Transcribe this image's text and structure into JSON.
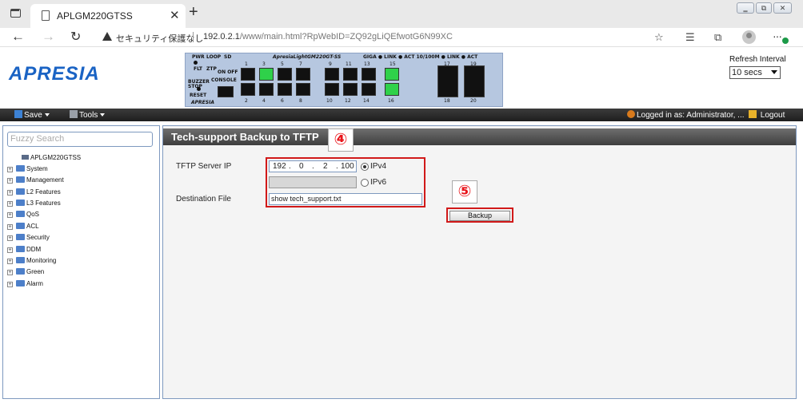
{
  "browser": {
    "tab_title": "APLGM220GTSS",
    "security_label": "セキュリティ保護なし",
    "url_host": "192.0.2.1",
    "url_path": "/www/main.html?RpWebID=ZQ92gLiQEfwotG6N99XC"
  },
  "header": {
    "logo": "APRESIA",
    "refresh_label": "Refresh Interval",
    "refresh_value": "10 secs",
    "panel": {
      "model": "ApresiaLightGM220GT-SS",
      "legend": "GIGA ● LINK ● ACT  10/100M ● LINK ● ACT",
      "led_labels": [
        "PWR",
        "LOOP",
        "SD",
        "FLT",
        "ZTP",
        "ON OFF",
        "BUZZER STOP",
        "CONSOLE",
        "RESET",
        "APRESIA"
      ],
      "top_ports": [
        "1",
        "3",
        "5",
        "7",
        "9",
        "11",
        "13",
        "15",
        "17",
        "19"
      ],
      "bottom_ports": [
        "2",
        "4",
        "6",
        "8",
        "10",
        "12",
        "14",
        "16",
        "18",
        "20"
      ],
      "link_up_ports": [
        "3",
        "15",
        "16"
      ]
    }
  },
  "menubar": {
    "save": "Save",
    "tools": "Tools",
    "logged_in": "Logged in as: Administrator, ...",
    "logout": "Logout"
  },
  "sidebar": {
    "search_placeholder": "Fuzzy Search",
    "root": "APLGM220GTSS",
    "items": [
      "System",
      "Management",
      "L2 Features",
      "L3 Features",
      "QoS",
      "ACL",
      "Security",
      "DDM",
      "Monitoring",
      "Green",
      "Alarm"
    ]
  },
  "main": {
    "title": "Tech-support Backup to TFTP",
    "server_ip_label": "TFTP Server IP",
    "ip_octets": [
      "192",
      "0",
      "2",
      "100"
    ],
    "ipv4_label": "IPv4",
    "ipv6_label": "IPv6",
    "dest_label": "Destination File",
    "dest_value": "show tech_support.txt",
    "backup_label": "Backup",
    "callout_4": "④",
    "callout_5": "⑤",
    "highlight_color": "#d11919"
  }
}
